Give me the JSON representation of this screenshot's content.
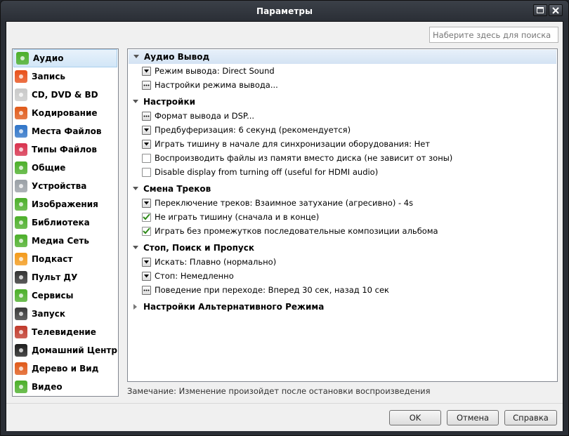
{
  "window": {
    "title": "Параметры"
  },
  "search": {
    "placeholder": "Наберите здесь для поиска"
  },
  "sidebar": {
    "items": [
      {
        "label": "Аудио",
        "icon": "audio-icon",
        "color": "#4caf2a",
        "selected": true
      },
      {
        "label": "Запись",
        "icon": "record-icon",
        "color": "#e8501a"
      },
      {
        "label": "CD, DVD & BD",
        "icon": "disc-icon",
        "color": "#c9c9c9"
      },
      {
        "label": "Кодирование",
        "icon": "encoding-icon",
        "color": "#e05a1a"
      },
      {
        "label": "Места Файлов",
        "icon": "compass-icon",
        "color": "#2f74c8"
      },
      {
        "label": "Типы Файлов",
        "icon": "file-types-icon",
        "color": "#d8324e"
      },
      {
        "label": "Общие",
        "icon": "checkmark-icon",
        "color": "#4caf2a"
      },
      {
        "label": "Устройства",
        "icon": "device-icon",
        "color": "#9aa0a6"
      },
      {
        "label": "Изображения",
        "icon": "images-icon",
        "color": "#4caf2a"
      },
      {
        "label": "Библиотека",
        "icon": "library-icon",
        "color": "#4caf2a"
      },
      {
        "label": "Медиа Сеть",
        "icon": "media-network-icon",
        "color": "#4caf2a"
      },
      {
        "label": "Подкаст",
        "icon": "podcast-icon",
        "color": "#f39a1b"
      },
      {
        "label": "Пульт ДУ",
        "icon": "remote-icon",
        "color": "#333333"
      },
      {
        "label": "Сервисы",
        "icon": "services-icon",
        "color": "#4caf2a"
      },
      {
        "label": "Запуск",
        "icon": "startup-icon",
        "color": "#3a3a3a"
      },
      {
        "label": "Телевидение",
        "icon": "tv-icon",
        "color": "#c0392b"
      },
      {
        "label": "Домашний Центр",
        "icon": "home-theater-icon",
        "color": "#1e1e1e"
      },
      {
        "label": "Дерево и Вид",
        "icon": "tree-view-icon",
        "color": "#e05a1a"
      },
      {
        "label": "Видео",
        "icon": "video-icon",
        "color": "#4caf2a"
      }
    ]
  },
  "sections": [
    {
      "title": "Аудио Вывод",
      "expanded": true,
      "rows": [
        {
          "type": "dropdown",
          "label": "Режим вывода: Direct Sound"
        },
        {
          "type": "ellipsis",
          "label": "Настройки режима вывода..."
        }
      ]
    },
    {
      "title": "Настройки",
      "expanded": true,
      "rows": [
        {
          "type": "ellipsis",
          "label": "Формат вывода и DSP..."
        },
        {
          "type": "dropdown",
          "label": "Предбуферизация: 6 секунд (рекомендуется)"
        },
        {
          "type": "dropdown",
          "label": "Играть тишину в начале для синхронизации оборудования: Нет"
        },
        {
          "type": "checkbox",
          "checked": false,
          "label": "Воспроизводить файлы из памяти вместо диска (не зависит от зоны)"
        },
        {
          "type": "checkbox",
          "checked": false,
          "label": "Disable display from turning off (useful for HDMI audio)"
        }
      ]
    },
    {
      "title": "Смена Треков",
      "expanded": true,
      "rows": [
        {
          "type": "dropdown",
          "label": "Переключение треков: Взаимное затухание (агресивно) - 4s"
        },
        {
          "type": "checkbox",
          "checked": true,
          "label": "Не играть тишину (сначала и в конце)"
        },
        {
          "type": "checkbox",
          "checked": true,
          "label": "Играть без промежутков последовательные композиции альбома"
        }
      ]
    },
    {
      "title": "Стоп, Поиск и Пропуск",
      "expanded": true,
      "rows": [
        {
          "type": "dropdown",
          "label": "Искать: Плавно (нормально)"
        },
        {
          "type": "dropdown",
          "label": "Стоп: Немедленно"
        },
        {
          "type": "ellipsis",
          "label": "Поведение при переходе: Вперед 30 сек, назад 10 сек"
        }
      ]
    },
    {
      "title": "Настройки Альтернативного Режима",
      "expanded": false,
      "rows": []
    }
  ],
  "footnote": "Замечание: Изменение произойдет после остановки воспроизведения",
  "buttons": {
    "ok": "OK",
    "cancel": "Отмена",
    "help": "Справка"
  },
  "colors": {
    "selection": "#d2e6f7",
    "checkmark": "#2f8a1a"
  }
}
